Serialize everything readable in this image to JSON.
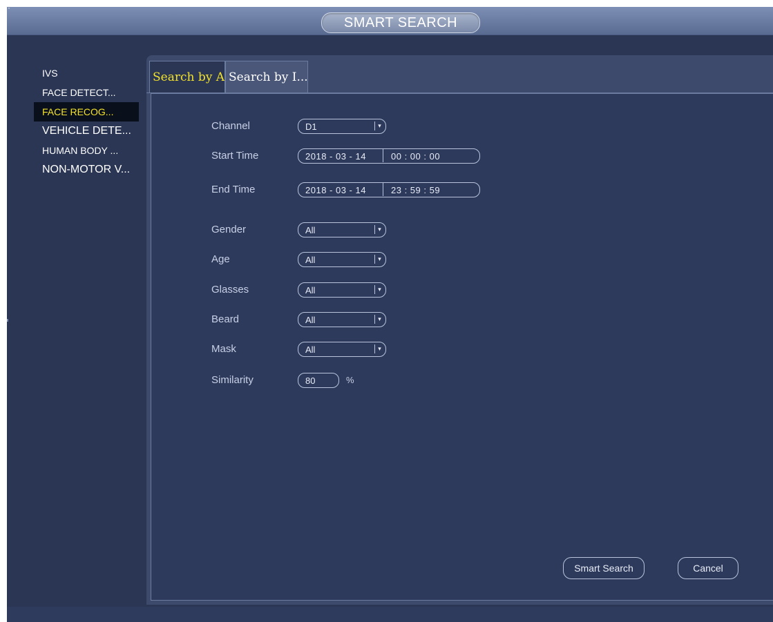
{
  "window": {
    "title": "SMART SEARCH"
  },
  "sidebar": {
    "items": [
      {
        "label": "IVS",
        "active": false
      },
      {
        "label": "FACE DETECT...",
        "active": false
      },
      {
        "label": "FACE RECOG...",
        "active": true
      },
      {
        "label": "VEHICLE DETE...",
        "active": false
      },
      {
        "label": "HUMAN BODY ...",
        "active": false
      },
      {
        "label": "NON-MOTOR V...",
        "active": false
      }
    ]
  },
  "tabs": [
    {
      "label": "Search by A.",
      "active": true
    },
    {
      "label": "Search by I...",
      "active": false
    }
  ],
  "form": {
    "channel": {
      "label": "Channel",
      "value": "D1"
    },
    "start_time": {
      "label": "Start Time",
      "date": "2018 - 03 - 14",
      "time": "00 : 00 : 00"
    },
    "end_time": {
      "label": "End Time",
      "date": "2018 - 03 - 14",
      "time": "23 : 59 : 59"
    },
    "gender": {
      "label": "Gender",
      "value": "All"
    },
    "age": {
      "label": "Age",
      "value": "All"
    },
    "glasses": {
      "label": "Glasses",
      "value": "All"
    },
    "beard": {
      "label": "Beard",
      "value": "All"
    },
    "mask": {
      "label": "Mask",
      "value": "All"
    },
    "similarity": {
      "label": "Similarity",
      "value": "80",
      "unit": "%"
    }
  },
  "buttons": {
    "smart_search": "Smart Search",
    "cancel": "Cancel"
  },
  "colors": {
    "background": "#2a3654",
    "panel": "#2d3a5c",
    "active_text": "#f3e22a",
    "label_text": "#c8d0e6"
  }
}
